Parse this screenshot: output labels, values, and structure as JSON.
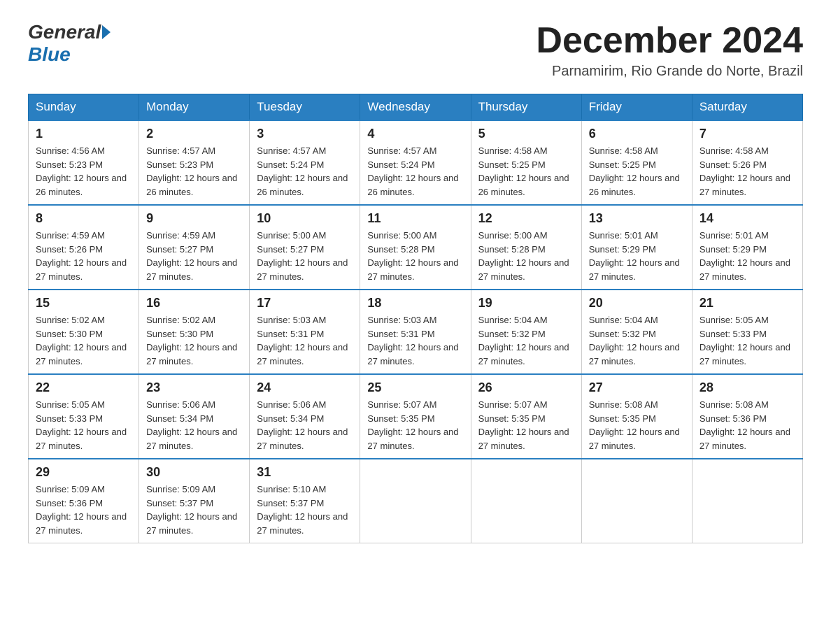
{
  "logo": {
    "general": "General",
    "blue": "Blue"
  },
  "title": "December 2024",
  "location": "Parnamirim, Rio Grande do Norte, Brazil",
  "days_of_week": [
    "Sunday",
    "Monday",
    "Tuesday",
    "Wednesday",
    "Thursday",
    "Friday",
    "Saturday"
  ],
  "weeks": [
    [
      {
        "day": "1",
        "sunrise": "4:56 AM",
        "sunset": "5:23 PM",
        "daylight": "12 hours and 26 minutes."
      },
      {
        "day": "2",
        "sunrise": "4:57 AM",
        "sunset": "5:23 PM",
        "daylight": "12 hours and 26 minutes."
      },
      {
        "day": "3",
        "sunrise": "4:57 AM",
        "sunset": "5:24 PM",
        "daylight": "12 hours and 26 minutes."
      },
      {
        "day": "4",
        "sunrise": "4:57 AM",
        "sunset": "5:24 PM",
        "daylight": "12 hours and 26 minutes."
      },
      {
        "day": "5",
        "sunrise": "4:58 AM",
        "sunset": "5:25 PM",
        "daylight": "12 hours and 26 minutes."
      },
      {
        "day": "6",
        "sunrise": "4:58 AM",
        "sunset": "5:25 PM",
        "daylight": "12 hours and 26 minutes."
      },
      {
        "day": "7",
        "sunrise": "4:58 AM",
        "sunset": "5:26 PM",
        "daylight": "12 hours and 27 minutes."
      }
    ],
    [
      {
        "day": "8",
        "sunrise": "4:59 AM",
        "sunset": "5:26 PM",
        "daylight": "12 hours and 27 minutes."
      },
      {
        "day": "9",
        "sunrise": "4:59 AM",
        "sunset": "5:27 PM",
        "daylight": "12 hours and 27 minutes."
      },
      {
        "day": "10",
        "sunrise": "5:00 AM",
        "sunset": "5:27 PM",
        "daylight": "12 hours and 27 minutes."
      },
      {
        "day": "11",
        "sunrise": "5:00 AM",
        "sunset": "5:28 PM",
        "daylight": "12 hours and 27 minutes."
      },
      {
        "day": "12",
        "sunrise": "5:00 AM",
        "sunset": "5:28 PM",
        "daylight": "12 hours and 27 minutes."
      },
      {
        "day": "13",
        "sunrise": "5:01 AM",
        "sunset": "5:29 PM",
        "daylight": "12 hours and 27 minutes."
      },
      {
        "day": "14",
        "sunrise": "5:01 AM",
        "sunset": "5:29 PM",
        "daylight": "12 hours and 27 minutes."
      }
    ],
    [
      {
        "day": "15",
        "sunrise": "5:02 AM",
        "sunset": "5:30 PM",
        "daylight": "12 hours and 27 minutes."
      },
      {
        "day": "16",
        "sunrise": "5:02 AM",
        "sunset": "5:30 PM",
        "daylight": "12 hours and 27 minutes."
      },
      {
        "day": "17",
        "sunrise": "5:03 AM",
        "sunset": "5:31 PM",
        "daylight": "12 hours and 27 minutes."
      },
      {
        "day": "18",
        "sunrise": "5:03 AM",
        "sunset": "5:31 PM",
        "daylight": "12 hours and 27 minutes."
      },
      {
        "day": "19",
        "sunrise": "5:04 AM",
        "sunset": "5:32 PM",
        "daylight": "12 hours and 27 minutes."
      },
      {
        "day": "20",
        "sunrise": "5:04 AM",
        "sunset": "5:32 PM",
        "daylight": "12 hours and 27 minutes."
      },
      {
        "day": "21",
        "sunrise": "5:05 AM",
        "sunset": "5:33 PM",
        "daylight": "12 hours and 27 minutes."
      }
    ],
    [
      {
        "day": "22",
        "sunrise": "5:05 AM",
        "sunset": "5:33 PM",
        "daylight": "12 hours and 27 minutes."
      },
      {
        "day": "23",
        "sunrise": "5:06 AM",
        "sunset": "5:34 PM",
        "daylight": "12 hours and 27 minutes."
      },
      {
        "day": "24",
        "sunrise": "5:06 AM",
        "sunset": "5:34 PM",
        "daylight": "12 hours and 27 minutes."
      },
      {
        "day": "25",
        "sunrise": "5:07 AM",
        "sunset": "5:35 PM",
        "daylight": "12 hours and 27 minutes."
      },
      {
        "day": "26",
        "sunrise": "5:07 AM",
        "sunset": "5:35 PM",
        "daylight": "12 hours and 27 minutes."
      },
      {
        "day": "27",
        "sunrise": "5:08 AM",
        "sunset": "5:35 PM",
        "daylight": "12 hours and 27 minutes."
      },
      {
        "day": "28",
        "sunrise": "5:08 AM",
        "sunset": "5:36 PM",
        "daylight": "12 hours and 27 minutes."
      }
    ],
    [
      {
        "day": "29",
        "sunrise": "5:09 AM",
        "sunset": "5:36 PM",
        "daylight": "12 hours and 27 minutes."
      },
      {
        "day": "30",
        "sunrise": "5:09 AM",
        "sunset": "5:37 PM",
        "daylight": "12 hours and 27 minutes."
      },
      {
        "day": "31",
        "sunrise": "5:10 AM",
        "sunset": "5:37 PM",
        "daylight": "12 hours and 27 minutes."
      },
      null,
      null,
      null,
      null
    ]
  ]
}
